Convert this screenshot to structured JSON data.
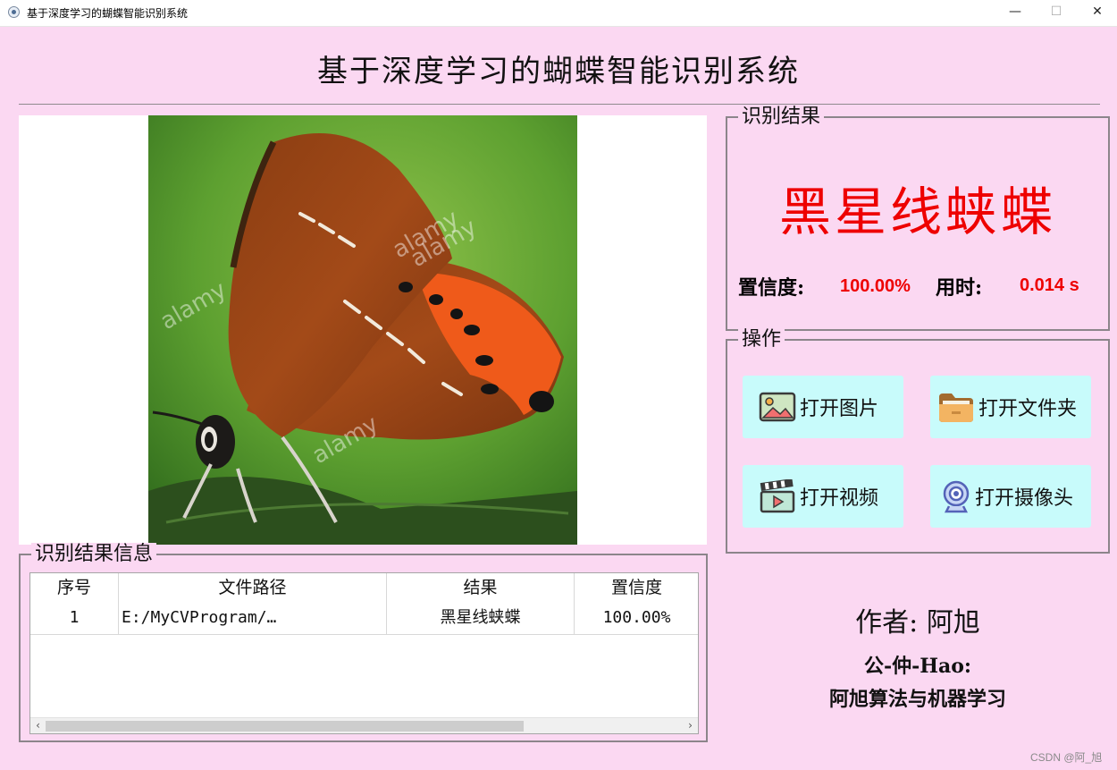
{
  "window": {
    "title": "基于深度学习的蝴蝶智能识别系统",
    "minimize": "—",
    "maximize": "☐",
    "close": "✕"
  },
  "app_title": "基于深度学习的蝴蝶智能识别系统",
  "image": {
    "watermark_text": "alamy"
  },
  "result": {
    "group_title": "识别结果",
    "name": "黑星线蛱蝶",
    "confidence_label": "置信度:",
    "confidence_value": "100.00%",
    "time_label": "用时:",
    "time_value": "0.014 s",
    "highlight_color": "#ee0000"
  },
  "operations": {
    "group_title": "操作",
    "buttons": [
      {
        "label": "打开图片",
        "icon": "image-icon"
      },
      {
        "label": "打开文件夹",
        "icon": "folder-icon"
      },
      {
        "label": "打开视频",
        "icon": "video-icon"
      },
      {
        "label": "打开摄像头",
        "icon": "webcam-icon"
      }
    ],
    "button_color": "#c8fbfb"
  },
  "info": {
    "group_title": "识别结果信息",
    "columns": [
      "序号",
      "文件路径",
      "结果",
      "置信度"
    ],
    "rows": [
      [
        "1",
        "E:/MyCVProgram/…",
        "黑星线蛱蝶",
        "100.00%"
      ]
    ]
  },
  "author": "作者: 阿旭",
  "gzh": "公-仲-Hao:",
  "tagline": "阿旭算法与机器学习",
  "watermark": "CSDN @阿_旭",
  "background_color": "#fbd8f2"
}
